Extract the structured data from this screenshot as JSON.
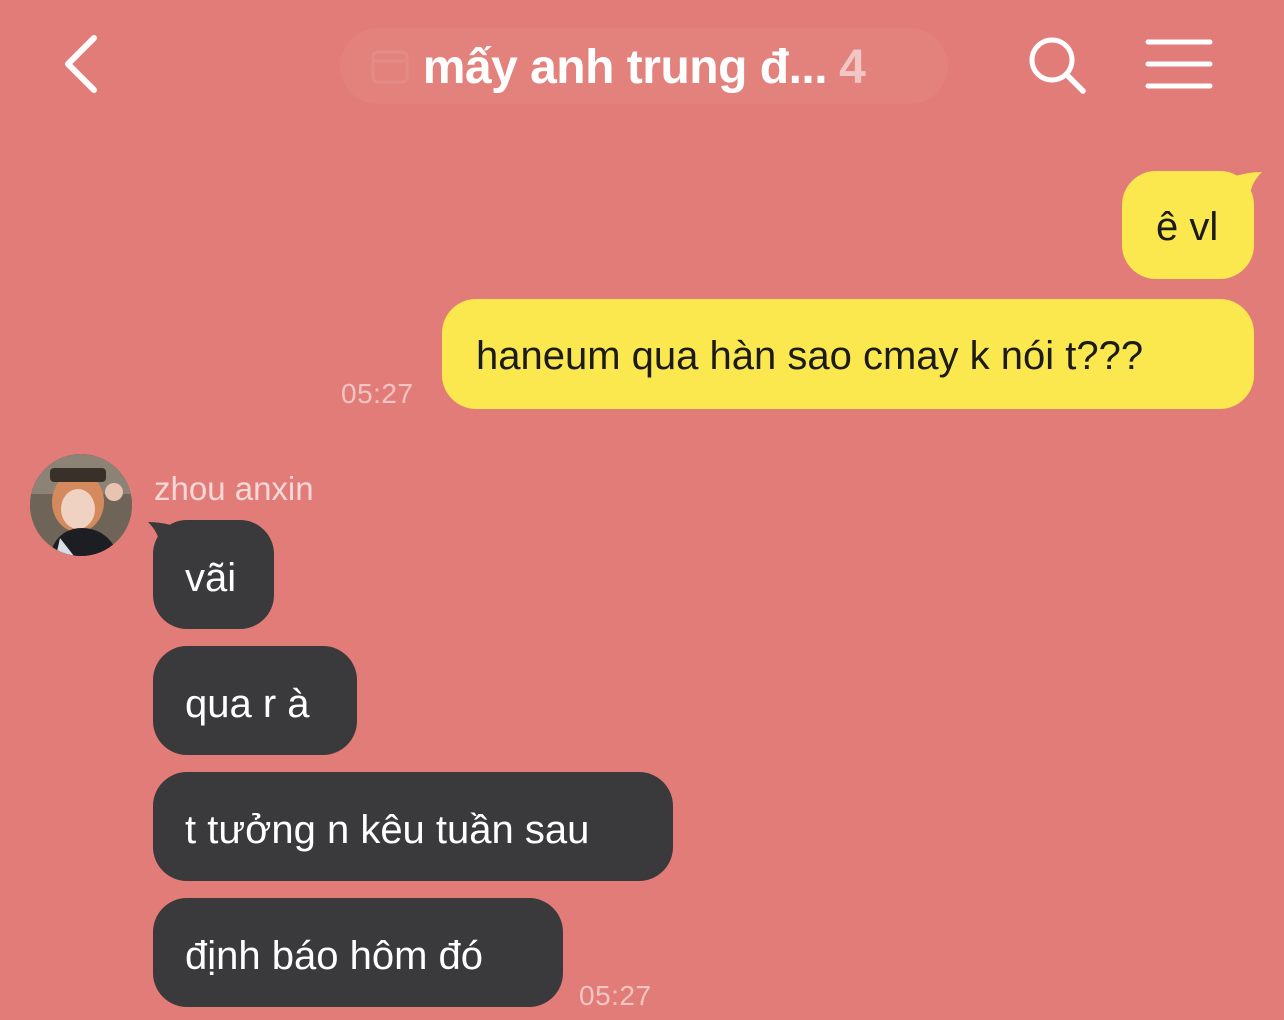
{
  "header": {
    "title": "mấy anh trung đ...",
    "member_count": "4",
    "back_icon": "chevron-left-icon",
    "search_icon": "search-icon",
    "menu_icon": "menu-icon"
  },
  "colors": {
    "background": "#e27c78",
    "outgoing_bubble": "#fbe74e",
    "incoming_bubble": "#3a393c"
  },
  "messages": {
    "outgoing": [
      {
        "text": "ê vl"
      },
      {
        "text": "haneum qua hàn sao cmay k nói t???"
      }
    ],
    "outgoing_time": "05:27",
    "sender_name": "zhou anxin",
    "incoming": [
      {
        "text": "vãi"
      },
      {
        "text": "qua r à"
      },
      {
        "text": "t tưởng n kêu tuần sau"
      },
      {
        "text": "định báo hôm đó"
      }
    ],
    "incoming_time": "05:27"
  }
}
